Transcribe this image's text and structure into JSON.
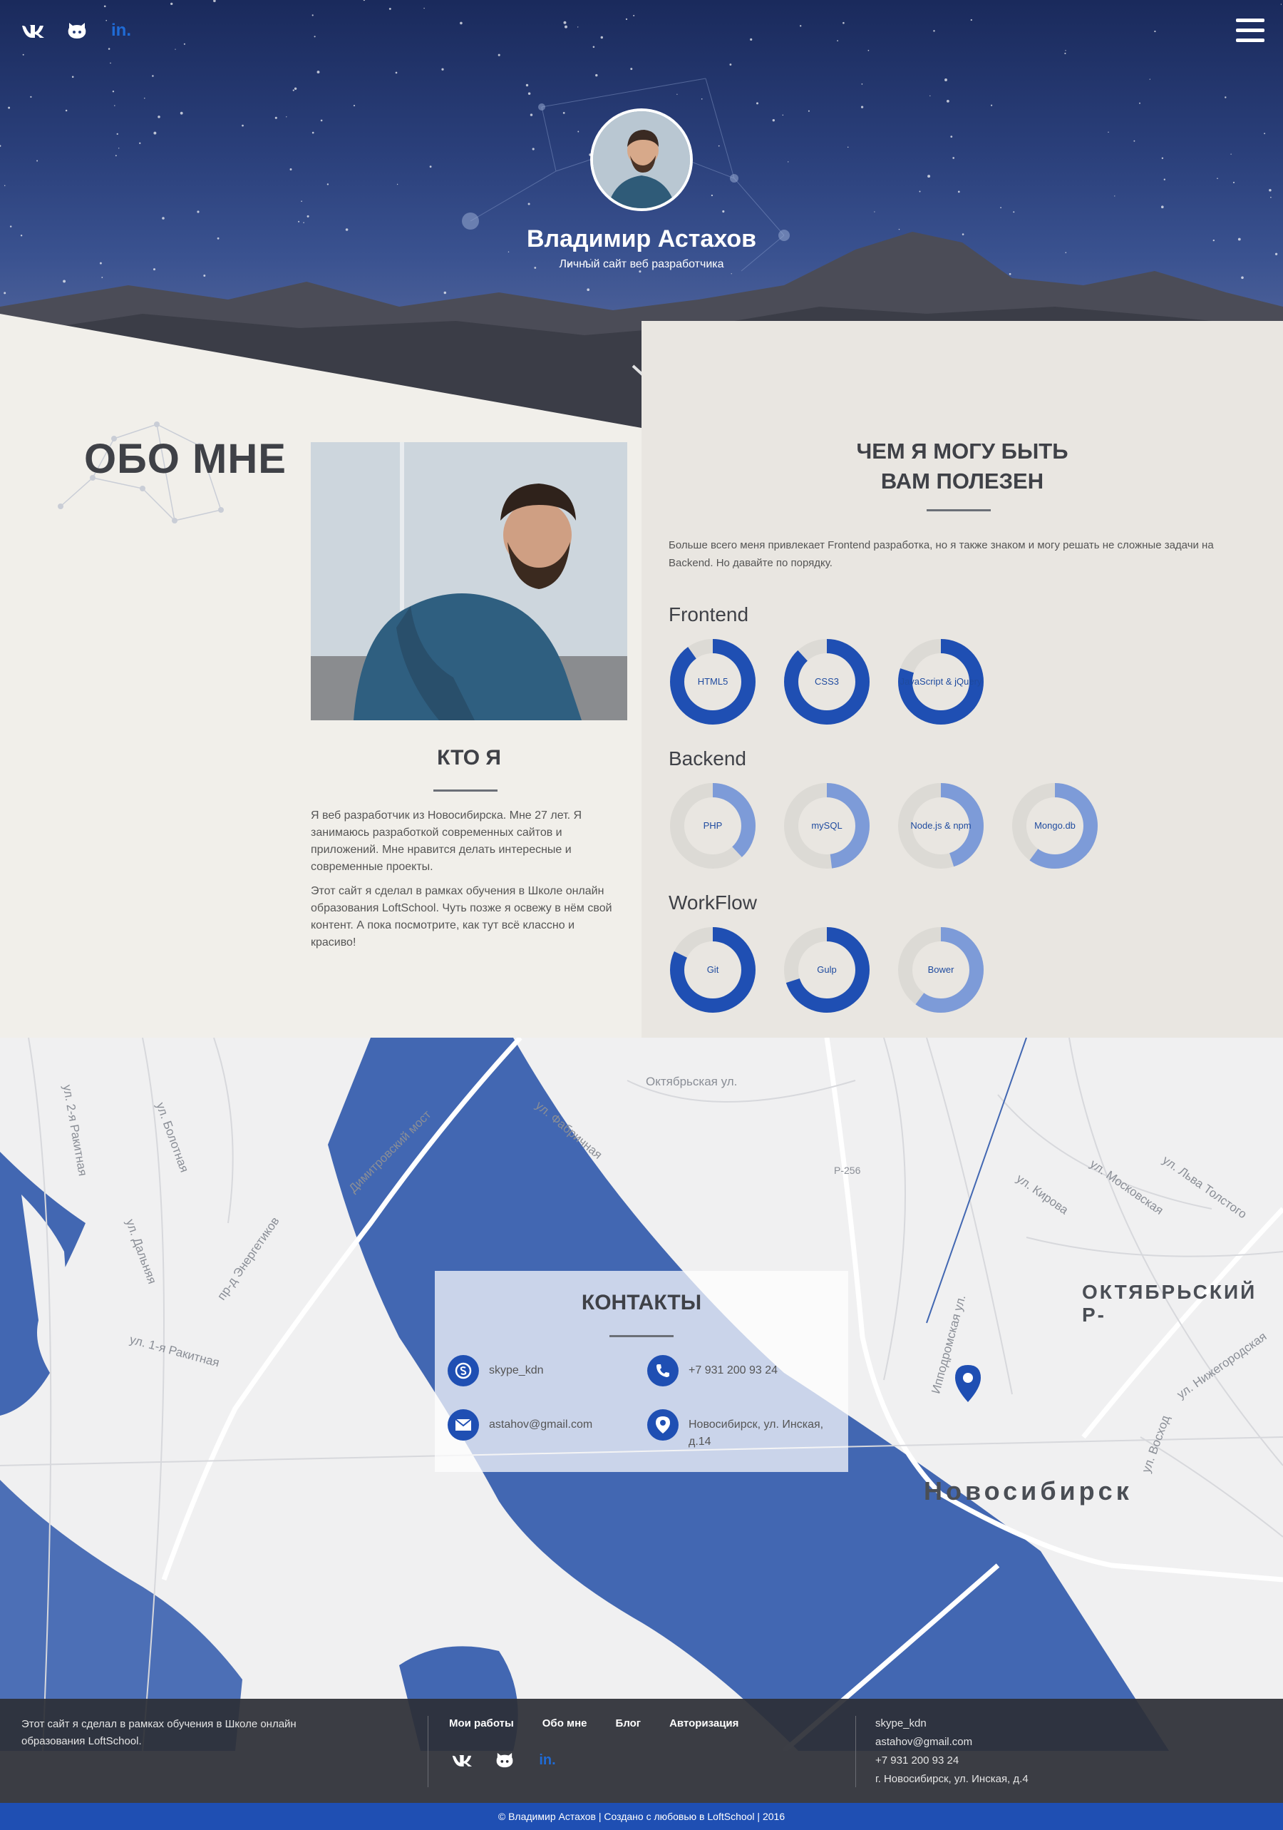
{
  "header": {
    "social": [
      {
        "icon": "vk-icon",
        "label": "vk"
      },
      {
        "icon": "github-icon",
        "label": "github"
      },
      {
        "icon": "linkedin-icon",
        "label": "in."
      }
    ],
    "menu_icon": "hamburger-icon",
    "name": "Владимир Астахов",
    "subtitle": "Личный сайт веб разработчика",
    "scroll_icon": "chevron-down-icon"
  },
  "about": {
    "title": "ОБО МНЕ",
    "who_title": "КТО Я",
    "who_paragraphs": [
      "Я веб разработчик из Новосибирска. Мне 27 лет. Я занимаюсь разработкой современных сайтов и приложений. Мне нравится делать интересные и современные проекты.",
      "Этот сайт я сделал в рамках обучения в Школе онлайн образования LoftSchool. Чуть позже я освежу в нём свой контент. А пока посмотрите, как тут всё классно и красиво!"
    ],
    "useful_title_line1": "ЧЕМ Я МОГУ БЫТЬ",
    "useful_title_line2": "ВАМ ПОЛЕЗЕН",
    "useful_text": "Больше всего меня привлекает Frontend разработка, но я также знаком и могу решать не сложные задачи на Backend. Но давайте по порядку.",
    "skill_groups": [
      {
        "title": "Frontend",
        "skills": [
          {
            "label": "HTML5",
            "level": 0.9
          },
          {
            "label": "CSS3",
            "level": 0.88
          },
          {
            "label": "JavaScript & jQuery",
            "level": 0.8
          }
        ]
      },
      {
        "title": "Backend",
        "skills": [
          {
            "label": "PHP",
            "level": 0.38
          },
          {
            "label": "mySQL",
            "level": 0.48
          },
          {
            "label": "Node.js & npm",
            "level": 0.45
          },
          {
            "label": "Mongo.db",
            "level": 0.6
          }
        ]
      },
      {
        "title": "WorkFlow",
        "skills": [
          {
            "label": "Git",
            "level": 0.82
          },
          {
            "label": "Gulp",
            "level": 0.7
          },
          {
            "label": "Bower",
            "level": 0.6
          }
        ]
      }
    ],
    "colors": {
      "ring": "#1f4fb3",
      "ring_light": "#7d9bd8",
      "track": "#dcdad5"
    }
  },
  "map": {
    "labels": [
      {
        "text": "Октябрьская ул."
      },
      {
        "text": "ул. Фабричная"
      },
      {
        "text": "ул. 2-я Ракитная"
      },
      {
        "text": "ул. Болотная"
      },
      {
        "text": "ул. Дальняя"
      },
      {
        "text": "ул. 1-я Ракитная"
      },
      {
        "text": "пр-д Энергетиков"
      },
      {
        "text": "Димитровский мост"
      },
      {
        "text": "ул. Кирова"
      },
      {
        "text": "ул. Московская"
      },
      {
        "text": "ул. Льва Толстого"
      },
      {
        "text": "Р-256"
      },
      {
        "text": "ул. Нижегородская"
      },
      {
        "text": "Ипподромская ул."
      },
      {
        "text": "ул. Восход"
      }
    ],
    "district": "ОКТЯБРЬСКИЙ Р-",
    "city": "Новосибирск",
    "water_color": "#4267b2"
  },
  "contacts": {
    "title": "КОНТАКТЫ",
    "items": [
      {
        "icon": "skype-icon",
        "text": "skype_kdn"
      },
      {
        "icon": "phone-icon",
        "text": "+7 931 200 93 24"
      },
      {
        "icon": "mail-icon",
        "text": "astahov@gmail.com"
      },
      {
        "icon": "location-icon",
        "text": "Новосибирск, ул. Инская, д.14"
      }
    ]
  },
  "footer": {
    "about": "Этот сайт я сделал в рамках обучения в Школе онлайн образования LoftSchool.",
    "nav": [
      "Мои работы",
      "Обо мне",
      "Блог",
      "Авторизация"
    ],
    "contacts": [
      "skype_kdn",
      "astahov@gmail.com",
      "+7 931 200 93 24",
      "г. Новосибирск, ул. Инская, д.4"
    ],
    "copyright": "© Владимир Астахов | Создано с любовью в LoftSchool | 2016"
  }
}
